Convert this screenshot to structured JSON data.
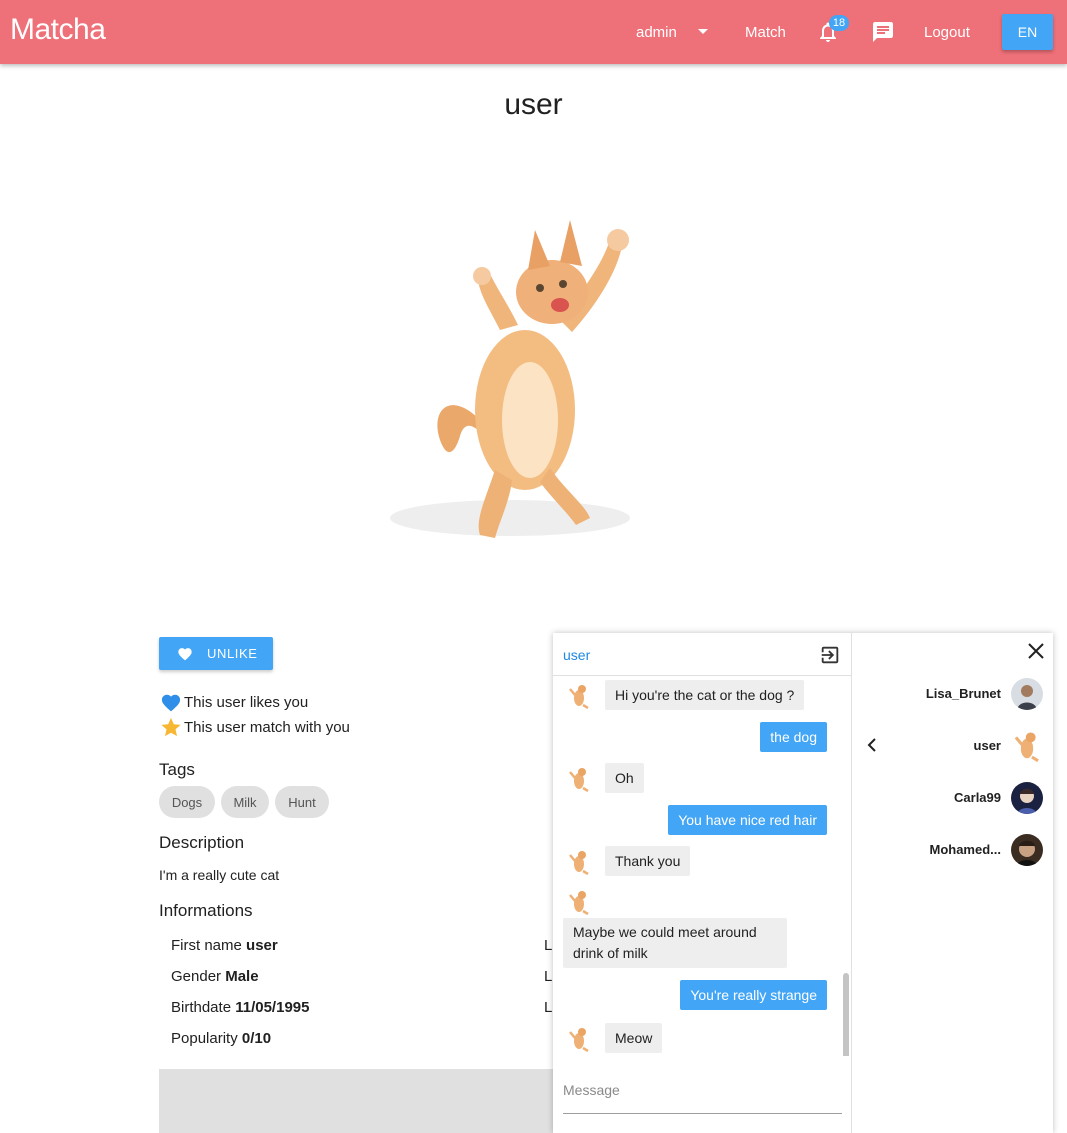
{
  "app": {
    "brand": "Matcha"
  },
  "nav": {
    "user": "admin",
    "match": "Match",
    "notifications_count": "18",
    "logout": "Logout",
    "language": "EN"
  },
  "profile": {
    "username": "user",
    "unlike_label": "UNLIKE",
    "likes_you": "This user likes you",
    "match_with_you": "This user match with you",
    "tags_title": "Tags",
    "tags": [
      "Dogs",
      "Milk",
      "Hunt"
    ],
    "description_title": "Description",
    "description": "I'm a really cute cat",
    "informations_title": "Informations",
    "info": [
      {
        "label": "First name",
        "value": "user"
      },
      {
        "label": "Gender",
        "value": "Male"
      },
      {
        "label": "Birthdate",
        "value": "11/05/1995"
      },
      {
        "label": "Popularity",
        "value": "0/10"
      }
    ],
    "info_right_clipped": [
      "L",
      "L",
      "L"
    ]
  },
  "chat": {
    "conversation_with": "user",
    "messages": [
      {
        "from": "them",
        "text": "Hi you're the cat or the dog ?"
      },
      {
        "from": "me",
        "text": "the dog"
      },
      {
        "from": "them",
        "text": "Oh"
      },
      {
        "from": "me",
        "text": "You have nice red hair"
      },
      {
        "from": "them",
        "text": "Thank you"
      },
      {
        "from": "them",
        "text": "Maybe we could meet around drink of milk"
      },
      {
        "from": "me",
        "text": "You're really strange"
      },
      {
        "from": "them",
        "text": "Meow"
      }
    ],
    "input_placeholder": "Message",
    "contacts": [
      {
        "name": "Lisa_Brunet",
        "active": false
      },
      {
        "name": "user",
        "active": true
      },
      {
        "name": "Carla99",
        "active": false
      },
      {
        "name": "Mohamed...",
        "active": false
      }
    ]
  },
  "colors": {
    "topbar": "#ee7078",
    "accent": "#42a5f5",
    "link": "#1e88e5"
  }
}
